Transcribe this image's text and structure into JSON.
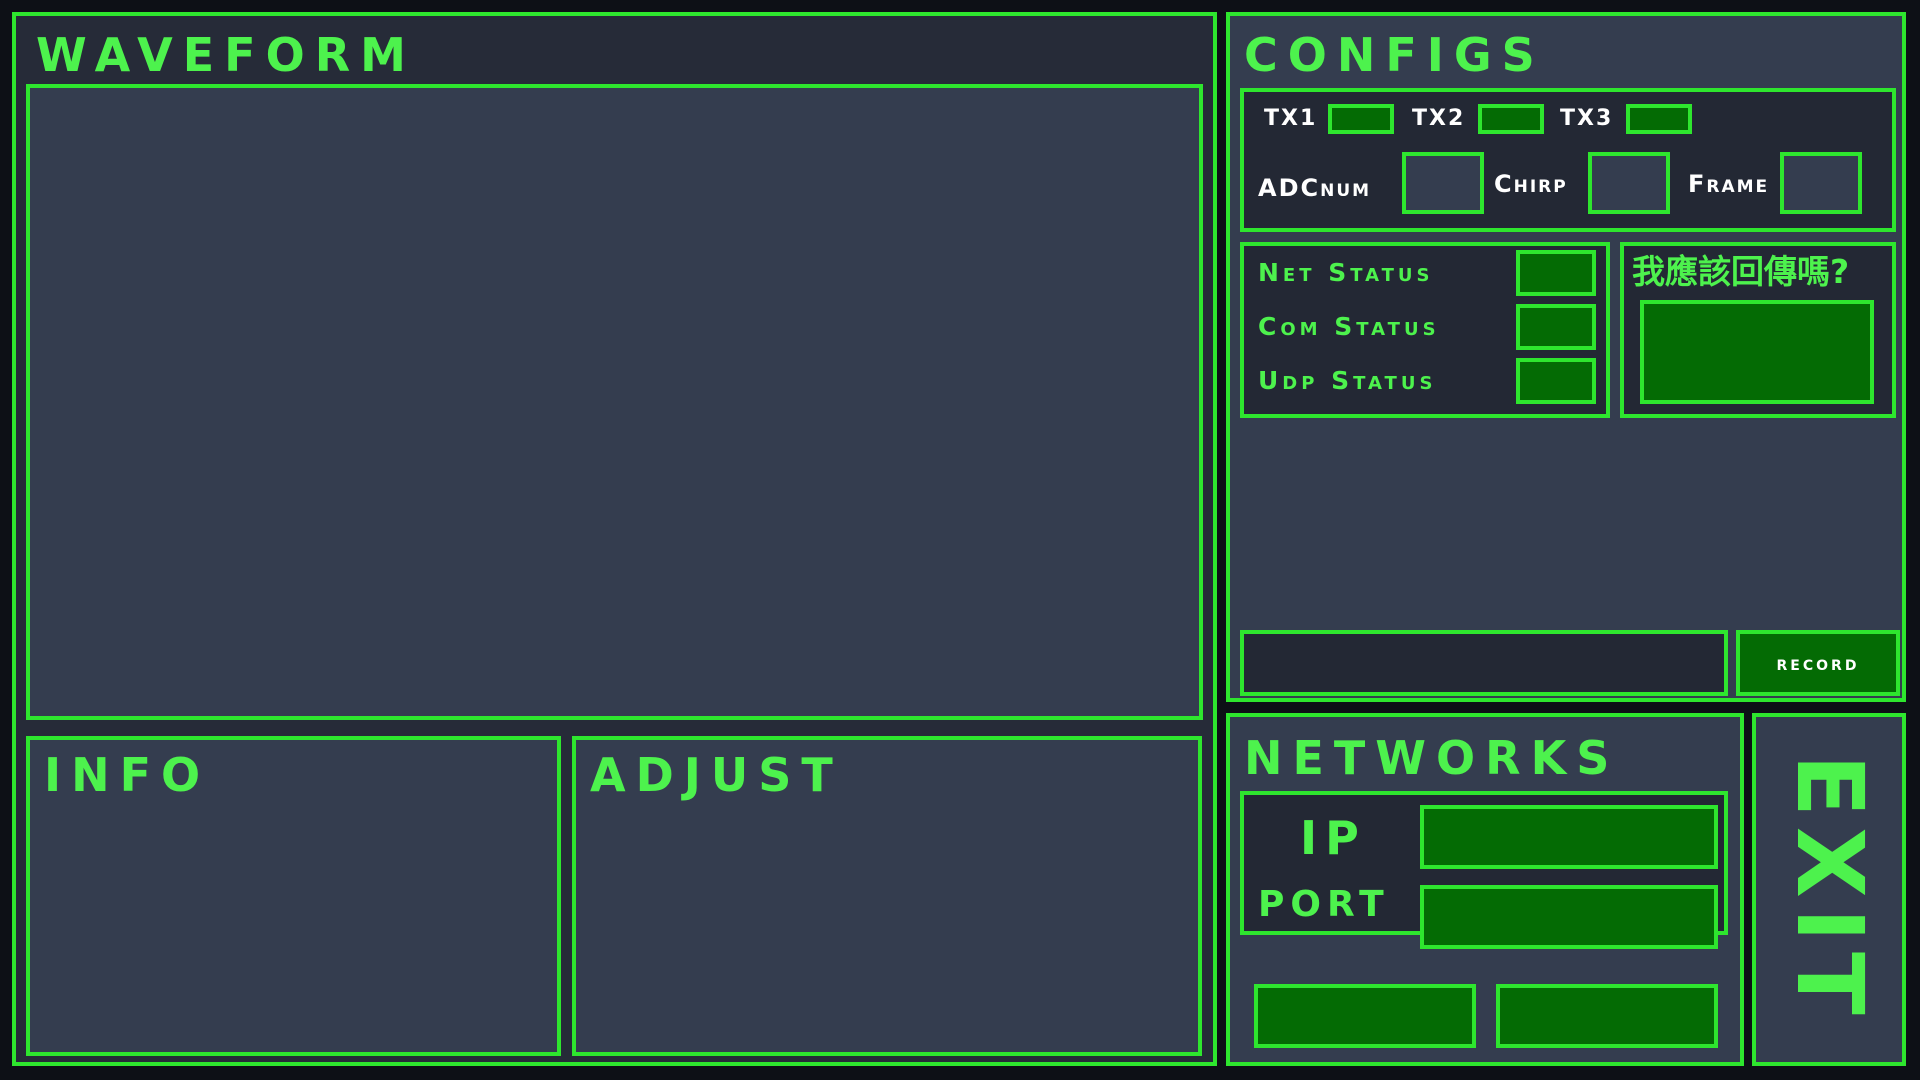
{
  "waveform": {
    "title": "WAVEFORM"
  },
  "info": {
    "title": "INFO"
  },
  "adjust": {
    "title": "ADJUST"
  },
  "configs": {
    "title": "CONFIGS",
    "tx1_label": "TX1",
    "tx2_label": "TX2",
    "tx3_label": "TX3",
    "adcnum_label": "ADCnum",
    "chirp_label": "Chirp",
    "frame_label": "Frame",
    "net_status_label": "Net Status",
    "com_status_label": "Com Status",
    "udp_status_label": "Udp Status",
    "question_label": "我應該回傳嗎?",
    "record_label": "record"
  },
  "networks": {
    "title": "NETWORKS",
    "ip_label": "IP",
    "port_label": "PORT"
  },
  "exit": {
    "label": "EXIT"
  },
  "colors": {
    "accent": "#2ee62e",
    "text_green": "#4df24d",
    "field_green": "#046b04",
    "panel_bg": "#343d4f",
    "outer_bg": "#262b38",
    "page_bg": "#0d1016"
  }
}
